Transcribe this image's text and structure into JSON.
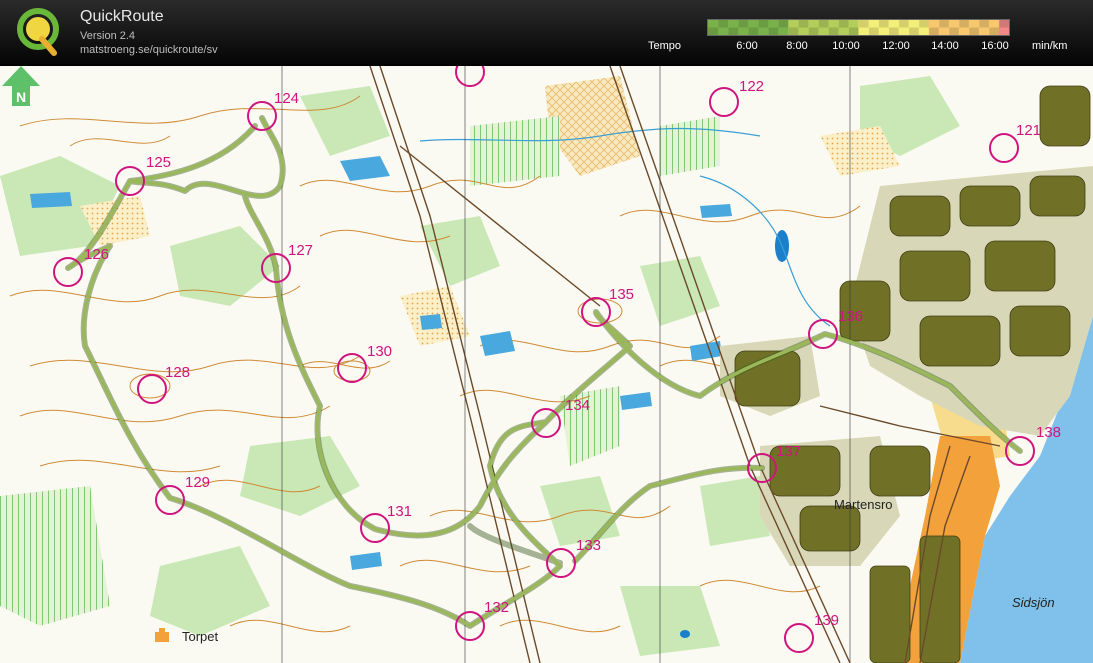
{
  "app": {
    "title": "QuickRoute",
    "version": "Version 2.4",
    "url": "matstroeng.se/quickroute/sv",
    "logo_letter": "Q"
  },
  "legend": {
    "label": "Tempo",
    "unit": "min/km",
    "ticks": [
      "6:00",
      "8:00",
      "10:00",
      "12:00",
      "14:00",
      "16:00"
    ],
    "colors": [
      "#79b24a",
      "#b3ce5a",
      "#f4ef78",
      "#f7c86e",
      "#f18a86"
    ]
  },
  "controls": [
    {
      "id": "122",
      "label": "122"
    },
    {
      "id": "121",
      "label": "121"
    },
    {
      "id": "124",
      "label": "124"
    },
    {
      "id": "125",
      "label": "125"
    },
    {
      "id": "126",
      "label": "126"
    },
    {
      "id": "127",
      "label": "127"
    },
    {
      "id": "128",
      "label": "128"
    },
    {
      "id": "129",
      "label": "129"
    },
    {
      "id": "130",
      "label": "130"
    },
    {
      "id": "131",
      "label": "131"
    },
    {
      "id": "132",
      "label": "132"
    },
    {
      "id": "133",
      "label": "133"
    },
    {
      "id": "134",
      "label": "134"
    },
    {
      "id": "135",
      "label": "135"
    },
    {
      "id": "136",
      "label": "136"
    },
    {
      "id": "137",
      "label": "137"
    },
    {
      "id": "138",
      "label": "138"
    },
    {
      "id": "139",
      "label": "139"
    }
  ],
  "places": {
    "town": "Martensro",
    "farm": "Torpet",
    "lake": "Sidsjön"
  },
  "colors": {
    "control": "#d0147f",
    "route": "#9ab85a",
    "contour": "#c8862e",
    "water": "#39a0d8",
    "lake": "#7fbfe8",
    "urban": "#6f6f2e",
    "green": "#c6e6b4",
    "yellow": "#f7dc8e"
  }
}
